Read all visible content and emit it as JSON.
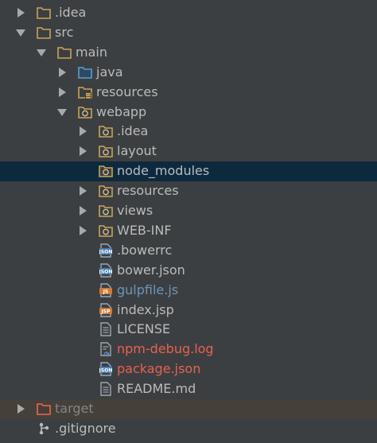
{
  "tree": {
    "items": [
      {
        "label": ".idea",
        "indent": 0,
        "arrow": "collapsed",
        "icon": "folder-icon",
        "color": "normal"
      },
      {
        "label": "src",
        "indent": 0,
        "arrow": "expanded",
        "icon": "folder-icon",
        "color": "normal"
      },
      {
        "label": "main",
        "indent": 1,
        "arrow": "expanded",
        "icon": "folder-icon",
        "color": "normal"
      },
      {
        "label": "java",
        "indent": 2,
        "arrow": "collapsed",
        "icon": "source-folder-icon",
        "color": "normal"
      },
      {
        "label": "resources",
        "indent": 2,
        "arrow": "collapsed",
        "icon": "resources-folder-icon",
        "color": "normal"
      },
      {
        "label": "webapp",
        "indent": 2,
        "arrow": "expanded",
        "icon": "web-folder-icon",
        "color": "normal"
      },
      {
        "label": ".idea",
        "indent": 3,
        "arrow": "collapsed",
        "icon": "web-folder-icon",
        "color": "normal"
      },
      {
        "label": "layout",
        "indent": 3,
        "arrow": "collapsed",
        "icon": "web-folder-icon",
        "color": "normal"
      },
      {
        "label": "node_modules",
        "indent": 3,
        "arrow": "none",
        "icon": "web-folder-icon",
        "color": "normal",
        "selected": true
      },
      {
        "label": "resources",
        "indent": 3,
        "arrow": "collapsed",
        "icon": "web-folder-icon",
        "color": "normal"
      },
      {
        "label": "views",
        "indent": 3,
        "arrow": "collapsed",
        "icon": "web-folder-icon",
        "color": "normal"
      },
      {
        "label": "WEB-INF",
        "indent": 3,
        "arrow": "collapsed",
        "icon": "web-folder-icon",
        "color": "normal"
      },
      {
        "label": ".bowerrc",
        "indent": 3,
        "arrow": "none",
        "icon": "json-file-icon",
        "color": "normal"
      },
      {
        "label": "bower.json",
        "indent": 3,
        "arrow": "none",
        "icon": "json-file-icon",
        "color": "normal"
      },
      {
        "label": "gulpfile.js",
        "indent": 3,
        "arrow": "none",
        "icon": "js-file-icon",
        "color": "blue"
      },
      {
        "label": "index.jsp",
        "indent": 3,
        "arrow": "none",
        "icon": "jsp-file-icon",
        "color": "normal"
      },
      {
        "label": "LICENSE",
        "indent": 3,
        "arrow": "none",
        "icon": "text-file-icon",
        "color": "normal"
      },
      {
        "label": "npm-debug.log",
        "indent": 3,
        "arrow": "none",
        "icon": "log-file-icon",
        "color": "red"
      },
      {
        "label": "package.json",
        "indent": 3,
        "arrow": "none",
        "icon": "json-file-icon",
        "color": "red"
      },
      {
        "label": "README.md",
        "indent": 3,
        "arrow": "none",
        "icon": "text-file-icon",
        "color": "normal"
      },
      {
        "label": "target",
        "indent": 0,
        "arrow": "collapsed",
        "icon": "excluded-folder-icon",
        "color": "dim",
        "excluded": true
      },
      {
        "label": ".gitignore",
        "indent": 0,
        "arrow": "none",
        "icon": "git-file-icon",
        "color": "normal"
      }
    ],
    "icon_badges": {
      "json": "JSON",
      "js": "JS",
      "jsp": "JSP"
    }
  }
}
